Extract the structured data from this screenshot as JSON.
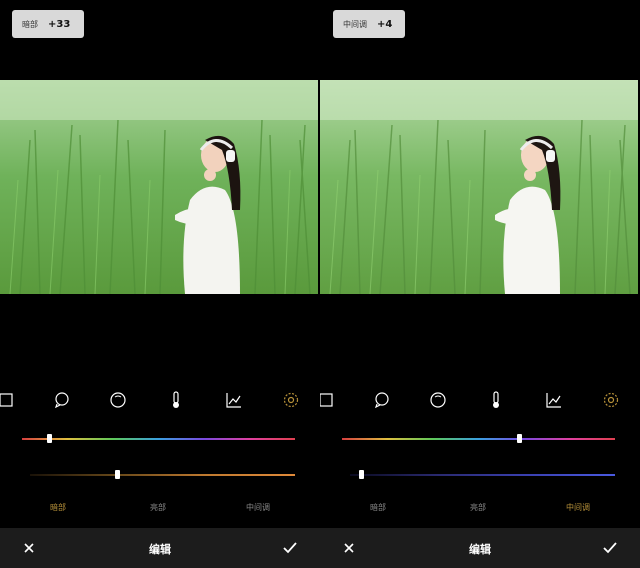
{
  "left": {
    "badge": {
      "label": "暗部",
      "value": "+33"
    },
    "tools": [
      "crop-icon",
      "chat-bubble-icon",
      "dial-icon",
      "thermometer-icon",
      "curve-chart-icon",
      "gear-icon"
    ],
    "slider_top": {
      "value_fraction": 0.1,
      "gradient": "spectrum"
    },
    "slider_bottom": {
      "value_fraction": 0.33,
      "gradient": "warm"
    },
    "tabs": [
      {
        "label": "暗部",
        "active": true
      },
      {
        "label": "亮部",
        "active": false
      },
      {
        "label": "中间调",
        "active": false
      }
    ],
    "bottom": {
      "title": "编辑"
    }
  },
  "right": {
    "badge": {
      "label": "中间调",
      "value": "+4"
    },
    "tools": [
      "crop-icon",
      "chat-bubble-icon",
      "dial-icon",
      "thermometer-icon",
      "curve-chart-icon",
      "gear-icon"
    ],
    "slider_top": {
      "value_fraction": 0.65,
      "gradient": "spectrum"
    },
    "slider_bottom": {
      "value_fraction": 0.04,
      "gradient": "cool"
    },
    "tabs": [
      {
        "label": "暗部",
        "active": false
      },
      {
        "label": "亮部",
        "active": false
      },
      {
        "label": "中间调",
        "active": true
      }
    ],
    "bottom": {
      "title": "编辑"
    }
  },
  "colors": {
    "accent": "#b8923a",
    "tab_inactive": "#8a8a8a",
    "bottom_bar": "#1c1c1c",
    "badge_bg": "#d9d9d9"
  }
}
